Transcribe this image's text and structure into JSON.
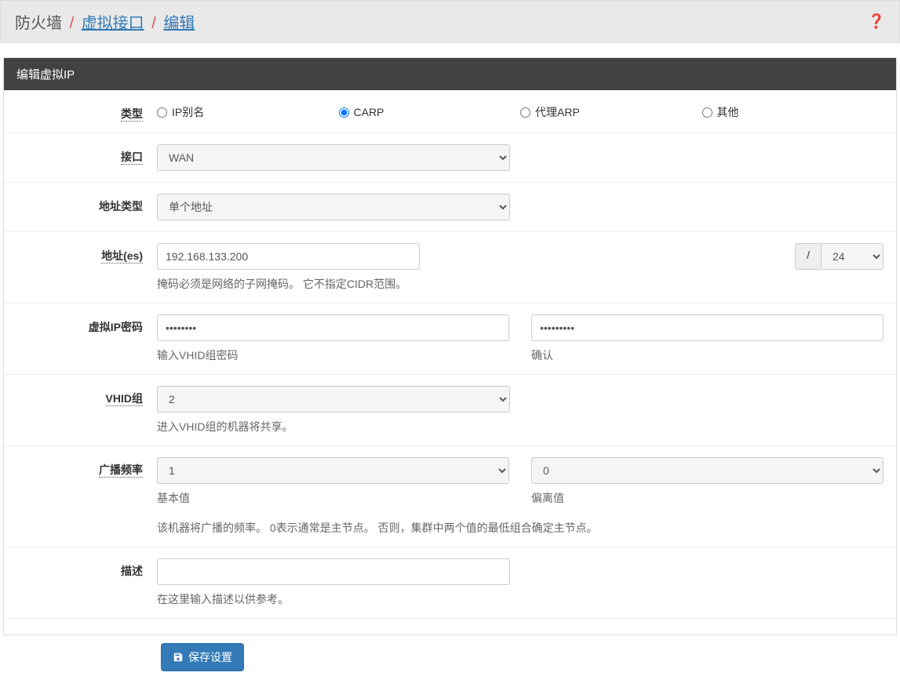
{
  "breadcrumb": {
    "root": "防火墙",
    "link1": "虚拟接口",
    "current": "编辑"
  },
  "panel": {
    "title": "编辑虚拟IP"
  },
  "fields": {
    "type": {
      "label": "类型",
      "options": {
        "ipalias": "IP别名",
        "carp": "CARP",
        "proxyarp": "代理ARP",
        "other": "其他"
      }
    },
    "interface": {
      "label": "接口",
      "value": "WAN"
    },
    "addrType": {
      "label": "地址类型",
      "value": "单个地址"
    },
    "address": {
      "label": "地址(es)",
      "value": "192.168.133.200",
      "slash": "/",
      "cidr": "24",
      "help": "掩码必须是网络的子网掩码。 它不指定CIDR范围。"
    },
    "vipPass": {
      "label": "虚拟IP密码",
      "value1": "••••••••",
      "value2": "•••••••••",
      "help1": "输入VHID组密码",
      "help2": "确认"
    },
    "vhid": {
      "label": "VHID组",
      "value": "2",
      "help": "进入VHID组的机器将共享。"
    },
    "freq": {
      "label": "广播频率",
      "base": "1",
      "skew": "0",
      "help1": "基本值",
      "help2": "偏离值",
      "desc": "该机器将广播的频率。 0表示通常是主节点。 否则，集群中两个值的最低组合确定主节点。"
    },
    "descr": {
      "label": "描述",
      "value": "",
      "help": "在这里输入描述以供参考。"
    }
  },
  "actions": {
    "save": "保存设置"
  }
}
